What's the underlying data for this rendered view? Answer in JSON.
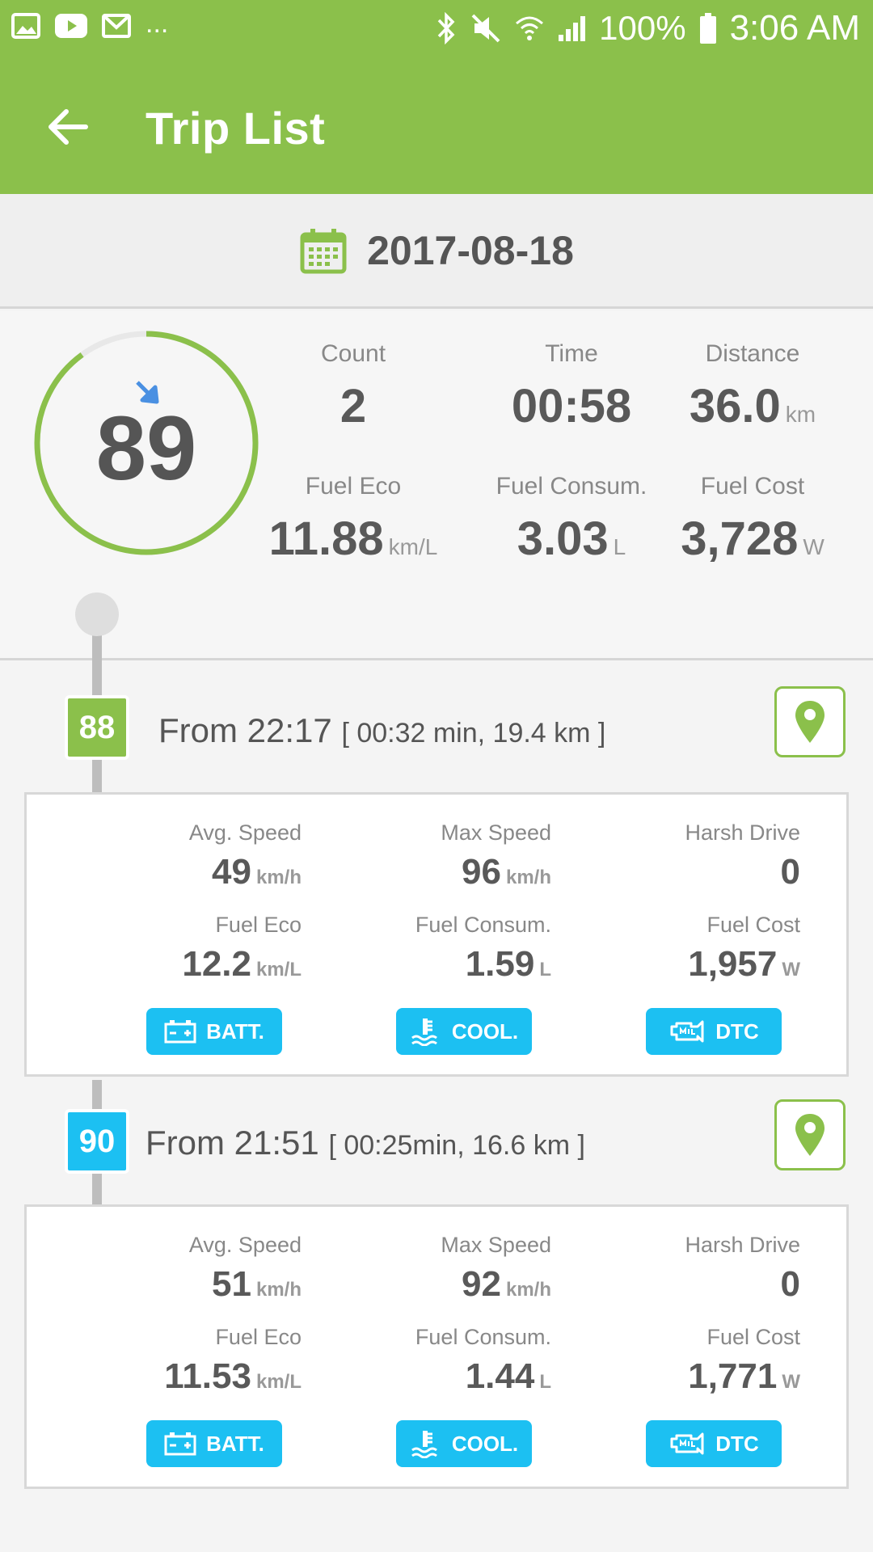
{
  "status_bar": {
    "dots": "...",
    "battery_pct": "100%",
    "time": "3:06 AM"
  },
  "app_bar": {
    "title": "Trip List"
  },
  "date_bar": {
    "date": "2017-08-18"
  },
  "summary": {
    "score": "89",
    "count_label": "Count",
    "count_value": "2",
    "time_label": "Time",
    "time_value": "00:58",
    "distance_label": "Distance",
    "distance_value": "36.0",
    "distance_unit": "km",
    "fuel_eco_label": "Fuel Eco",
    "fuel_eco_value": "11.88",
    "fuel_eco_unit": "km/L",
    "fuel_consum_label": "Fuel Consum.",
    "fuel_consum_value": "3.03",
    "fuel_consum_unit": "L",
    "fuel_cost_label": "Fuel Cost",
    "fuel_cost_value": "3,728",
    "fuel_cost_unit": "W"
  },
  "colors": {
    "primary_green": "#8bc04b",
    "accent_blue": "#1cc0f2",
    "trend_arrow": "#4a90e2"
  },
  "trips": [
    {
      "score": "88",
      "badge_color": "#8bc04b",
      "from": "From 22:17",
      "detail": "[ 00:32 min, 19.4 km ]",
      "avg_speed_label": "Avg. Speed",
      "avg_speed_value": "49",
      "speed_unit": "km/h",
      "max_speed_label": "Max Speed",
      "max_speed_value": "96",
      "harsh_label": "Harsh Drive",
      "harsh_value": "0",
      "fuel_eco_label": "Fuel Eco",
      "fuel_eco_value": "12.2",
      "fuel_eco_unit": "km/L",
      "fuel_consum_label": "Fuel Consum.",
      "fuel_consum_value": "1.59",
      "fuel_consum_unit": "L",
      "fuel_cost_label": "Fuel Cost",
      "fuel_cost_value": "1,957",
      "fuel_cost_unit": "W",
      "batt_label": "BATT.",
      "cool_label": "COOL.",
      "dtc_label": "DTC"
    },
    {
      "score": "90",
      "badge_color": "#1cc0f2",
      "from": "From 21:51",
      "detail": "[ 00:25min, 16.6 km ]",
      "avg_speed_label": "Avg. Speed",
      "avg_speed_value": "51",
      "speed_unit": "km/h",
      "max_speed_label": "Max Speed",
      "max_speed_value": "92",
      "harsh_label": "Harsh Drive",
      "harsh_value": "0",
      "fuel_eco_label": "Fuel Eco",
      "fuel_eco_value": "11.53",
      "fuel_eco_unit": "km/L",
      "fuel_consum_label": "Fuel Consum.",
      "fuel_consum_value": "1.44",
      "fuel_consum_unit": "L",
      "fuel_cost_label": "Fuel Cost",
      "fuel_cost_value": "1,771",
      "fuel_cost_unit": "W",
      "batt_label": "BATT.",
      "cool_label": "COOL.",
      "dtc_label": "DTC"
    }
  ]
}
